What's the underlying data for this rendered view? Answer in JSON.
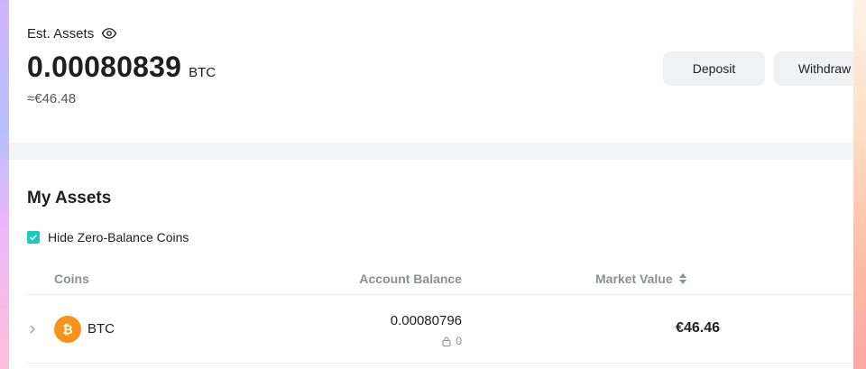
{
  "header": {
    "est_label": "Est. Assets",
    "balance": "0.00080839",
    "balance_unit": "BTC",
    "fiat_estimate": "≈€46.48",
    "deposit_label": "Deposit",
    "withdraw_label": "Withdraw",
    "icons": {
      "visibility": "eye-icon"
    }
  },
  "assets": {
    "title": "My Assets",
    "hide_zero_label": "Hide Zero-Balance Coins",
    "hide_zero_checked": true,
    "columns": {
      "coins": "Coins",
      "account_balance": "Account Balance",
      "market_value": "Market Value"
    },
    "rows": [
      {
        "coin": "BTC",
        "balance": "0.00080796",
        "locked": "0",
        "market_value": "€46.46"
      }
    ]
  },
  "colors": {
    "accent": "#1fc7c1",
    "btc": "#f7931a"
  }
}
